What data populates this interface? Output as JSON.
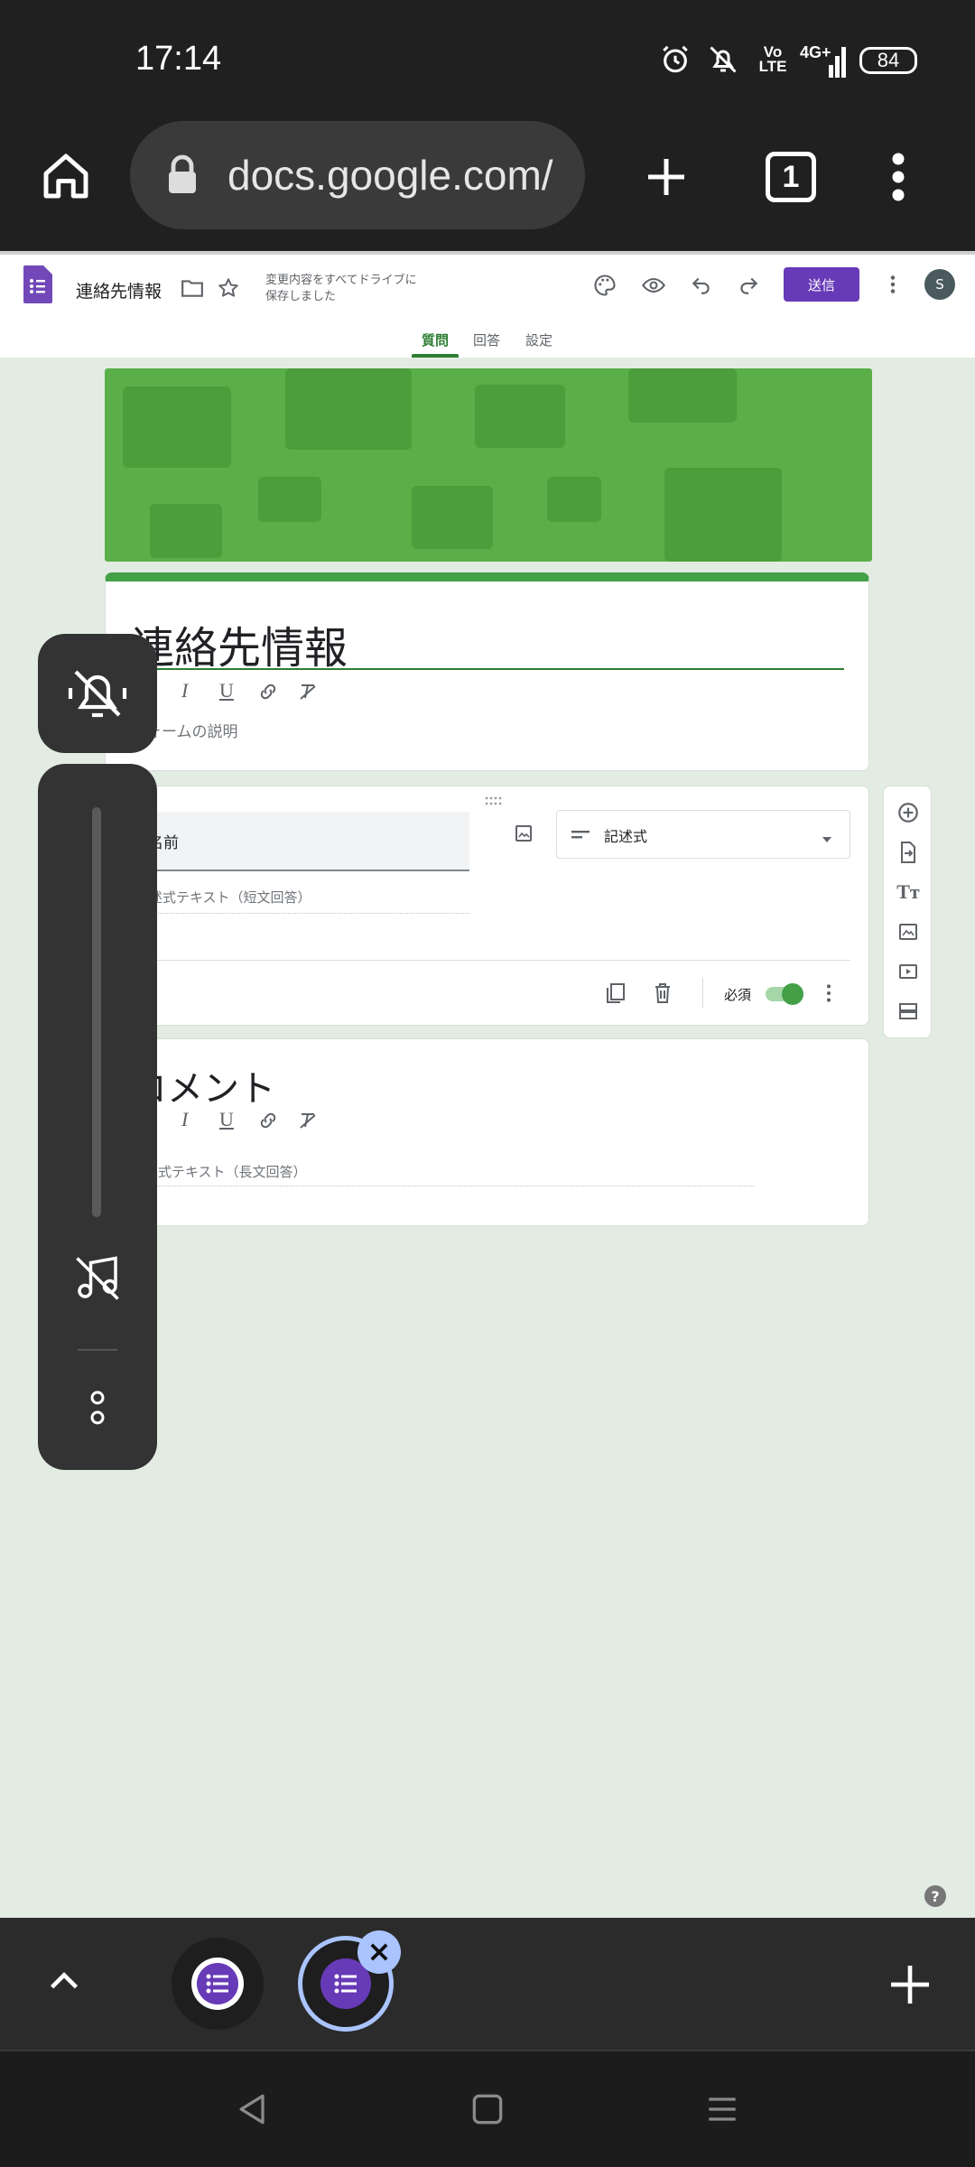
{
  "status_bar": {
    "time": "17:14",
    "network": "4G+",
    "volte": "Vo\nLTE",
    "battery": "84",
    "icons": [
      "alarm-icon",
      "notifications-off-icon",
      "volte-icon",
      "signal-icon",
      "battery-icon"
    ]
  },
  "browser": {
    "url": "docs.google.com/",
    "tab_count": "1"
  },
  "forms_header": {
    "doc_title": "連絡先情報",
    "save_status_line1": "変更内容をすべてドライブに",
    "save_status_line2": "保存しました",
    "send_label": "送信",
    "avatar_letter": "S",
    "tabs": [
      {
        "label": "質問",
        "active": true
      },
      {
        "label": "回答",
        "active": false
      },
      {
        "label": "設定",
        "active": false
      }
    ]
  },
  "form": {
    "title": "連絡先情報",
    "description_placeholder": "フォームの説明",
    "questions": [
      {
        "title": "名前",
        "type": "記述式",
        "answer_hint": "記述式テキスト（短文回答）",
        "required_label": "必須",
        "required": true
      },
      {
        "title": "コメント",
        "answer_hint": "記述式テキスト（長文回答）"
      }
    ]
  },
  "help": "?",
  "colors": {
    "accent_purple": "#673ab7",
    "theme_green": "#43a047",
    "banner_green": "#5aaf48",
    "background": "#e3ece3"
  }
}
